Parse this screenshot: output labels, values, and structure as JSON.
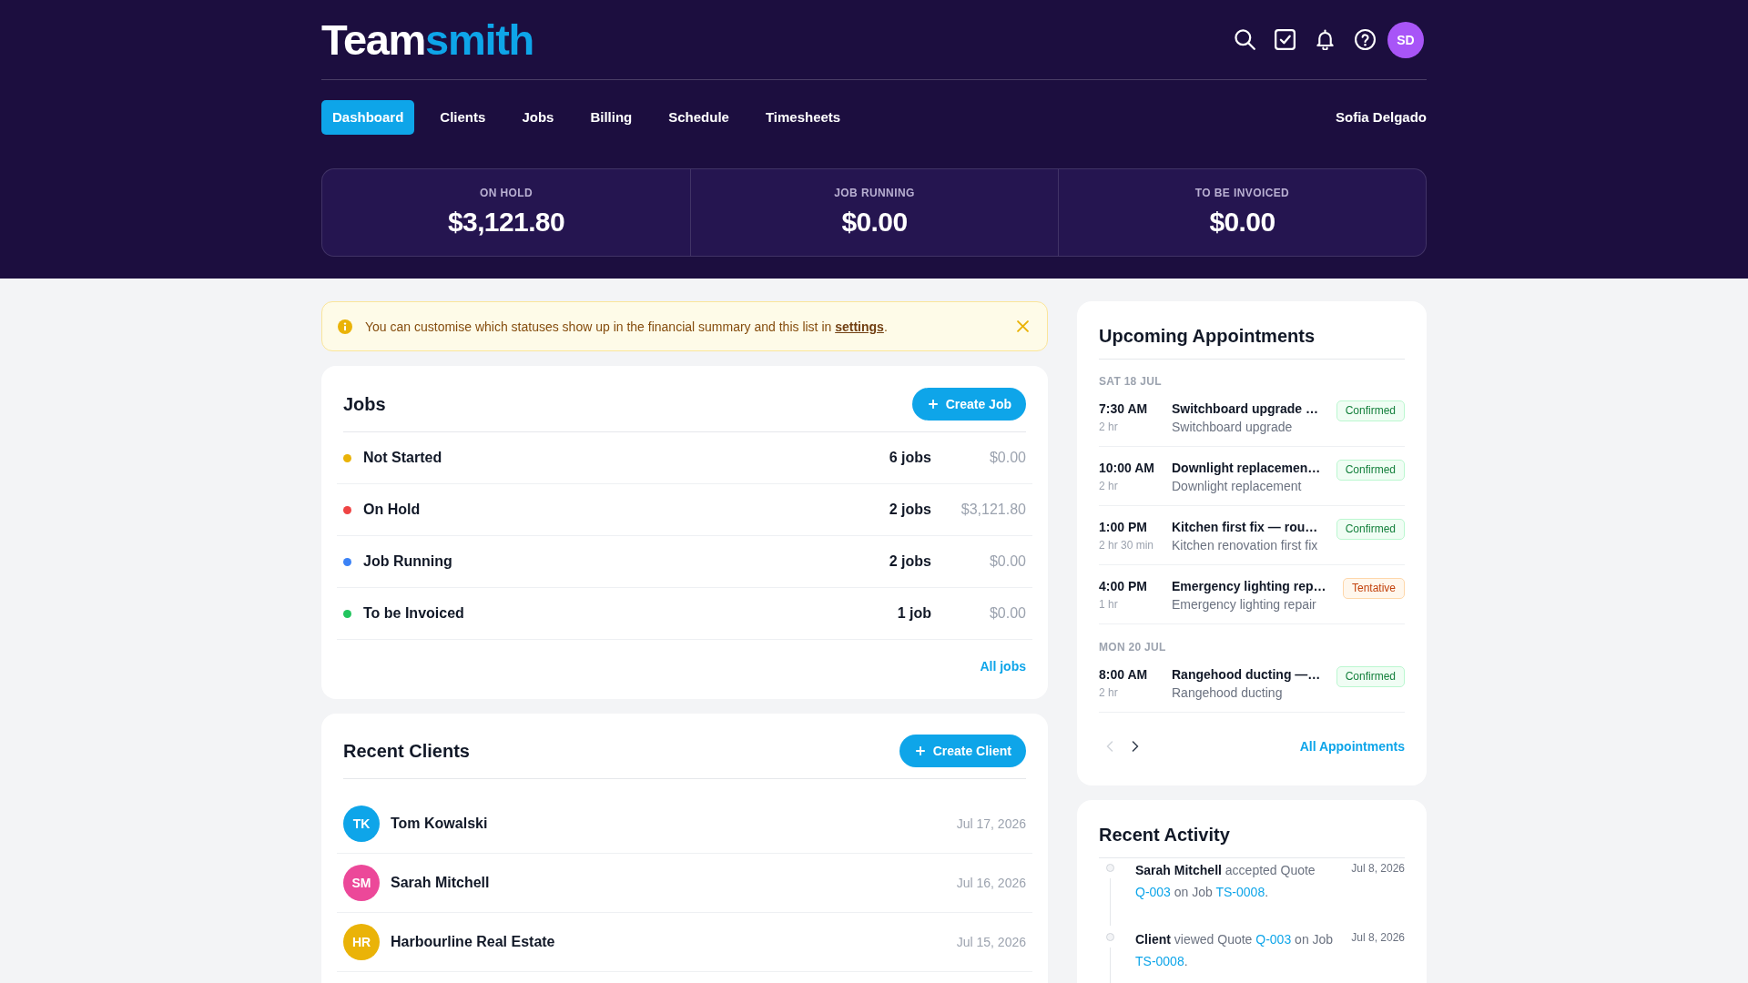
{
  "header": {
    "logo": {
      "main": "Team",
      "accent": "smith"
    },
    "avatar": "SD"
  },
  "nav": {
    "tabs": [
      {
        "label": "Dashboard",
        "selected": true
      },
      {
        "label": "Clients",
        "selected": false
      },
      {
        "label": "Jobs",
        "selected": false
      },
      {
        "label": "Billing",
        "selected": false
      },
      {
        "label": "Schedule",
        "selected": false
      },
      {
        "label": "Timesheets",
        "selected": false
      }
    ],
    "user_name": "Sofia Delgado"
  },
  "summary": [
    {
      "label": "ON HOLD",
      "value": "$3,121.80"
    },
    {
      "label": "JOB RUNNING",
      "value": "$0.00"
    },
    {
      "label": "TO BE INVOICED",
      "value": "$0.00"
    }
  ],
  "banner": {
    "segments": [
      {
        "kind": "text",
        "text": "You can customise which statuses show up in the financial summary and this list in "
      },
      {
        "kind": "link",
        "text": "settings"
      },
      {
        "kind": "text",
        "text": "."
      }
    ]
  },
  "jobs": {
    "title": "Jobs",
    "button": "Create Job",
    "rows": [
      {
        "status": "Not Started",
        "color": "#eab308",
        "count": "6 jobs",
        "amount": "$0.00"
      },
      {
        "status": "On Hold",
        "color": "#ef4444",
        "count": "2 jobs",
        "amount": "$3,121.80"
      },
      {
        "status": "Job Running",
        "color": "#3b82f6",
        "count": "2 jobs",
        "amount": "$0.00"
      },
      {
        "status": "To be Invoiced",
        "color": "#22c55e",
        "count": "1 job",
        "amount": "$0.00"
      }
    ],
    "link": "All jobs"
  },
  "recent_clients": {
    "title": "Recent Clients",
    "button": "Create Client",
    "rows": [
      {
        "initials": "TK",
        "name": "Tom Kowalski",
        "date": "Jul 17, 2026",
        "color": "#0ea5e9"
      },
      {
        "initials": "SM",
        "name": "Sarah Mitchell",
        "date": "Jul 16, 2026",
        "color": "#ec4899"
      },
      {
        "initials": "HR",
        "name": "Harbourline Real Estate",
        "date": "Jul 15, 2026",
        "color": "#eab308"
      }
    ]
  },
  "appointments": {
    "title": "Upcoming Appointments",
    "days": [
      {
        "date": "SAT 18 JUL",
        "items": [
          {
            "time": "7:30 AM",
            "duration": "2 hr",
            "title": "Switchboard upgrade …",
            "subtitle": "Switchboard upgrade",
            "badge": {
              "label": "Confirmed",
              "kind": "confirmed"
            }
          },
          {
            "time": "10:00 AM",
            "duration": "2 hr",
            "title": "Downlight replacemen…",
            "subtitle": "Downlight replacement",
            "badge": {
              "label": "Confirmed",
              "kind": "confirmed"
            }
          },
          {
            "time": "1:00 PM",
            "duration": "2 hr 30 min",
            "title": "Kitchen first fix — rou…",
            "subtitle": "Kitchen renovation first fix",
            "badge": {
              "label": "Confirmed",
              "kind": "confirmed"
            }
          },
          {
            "time": "4:00 PM",
            "duration": "1 hr",
            "title": "Emergency lighting rep…",
            "subtitle": "Emergency lighting repair",
            "badge": {
              "label": "Tentative",
              "kind": "tentative"
            }
          }
        ]
      },
      {
        "date": "MON 20 JUL",
        "items": [
          {
            "time": "8:00 AM",
            "duration": "2 hr",
            "title": "Rangehood ducting —…",
            "subtitle": "Rangehood ducting",
            "badge": {
              "label": "Confirmed",
              "kind": "confirmed"
            }
          }
        ]
      }
    ],
    "pager": [
      {
        "kind": "previous",
        "disabled": true
      },
      {
        "kind": "next",
        "disabled": false
      }
    ],
    "link": "All Appointments"
  },
  "activity": {
    "title": "Recent Activity",
    "items": [
      {
        "segments": [
          {
            "kind": "actor",
            "text": "Sarah Mitchell"
          },
          {
            "kind": "text",
            "text": " accepted Quote "
          },
          {
            "kind": "link",
            "text": "Q-003"
          },
          {
            "kind": "text",
            "text": " on Job "
          },
          {
            "kind": "link",
            "text": "TS-0008"
          },
          {
            "kind": "text",
            "text": "."
          }
        ],
        "date": "Jul 8, 2026"
      },
      {
        "segments": [
          {
            "kind": "actor",
            "text": "Client"
          },
          {
            "kind": "text",
            "text": " viewed Quote "
          },
          {
            "kind": "link",
            "text": "Q-003"
          },
          {
            "kind": "text",
            "text": " on Job "
          },
          {
            "kind": "link",
            "text": "TS-0008"
          },
          {
            "kind": "text",
            "text": "."
          }
        ],
        "date": "Jul 8, 2026"
      }
    ]
  }
}
